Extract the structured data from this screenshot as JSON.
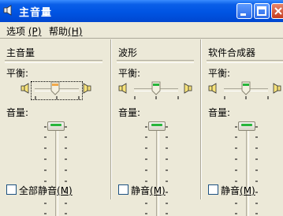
{
  "window": {
    "title": "主音量",
    "buttons": {
      "minimize": "minimize",
      "maximize": "maximize",
      "close": "close"
    }
  },
  "menubar": {
    "items": [
      {
        "label": "选项",
        "accel": "(P)"
      },
      {
        "label": "帮助",
        "accel": "(H)"
      }
    ]
  },
  "channels": [
    {
      "name": "主音量",
      "balance_label": "平衡:",
      "volume_label": "音量:",
      "mute_label": "全部静音",
      "mute_accel": "(M)",
      "mute_checked": false,
      "balance": 0.5,
      "volume": 1.0
    },
    {
      "name": "波形",
      "balance_label": "平衡:",
      "volume_label": "音量:",
      "mute_label": "静音",
      "mute_accel": "(M)",
      "mute_checked": false,
      "balance": 0.5,
      "volume": 1.0
    },
    {
      "name": "软件合成器",
      "balance_label": "平衡:",
      "volume_label": "音量:",
      "mute_label": "静音",
      "mute_accel": "(M)",
      "mute_checked": false,
      "balance": 0.5,
      "volume": 1.0
    }
  ]
}
